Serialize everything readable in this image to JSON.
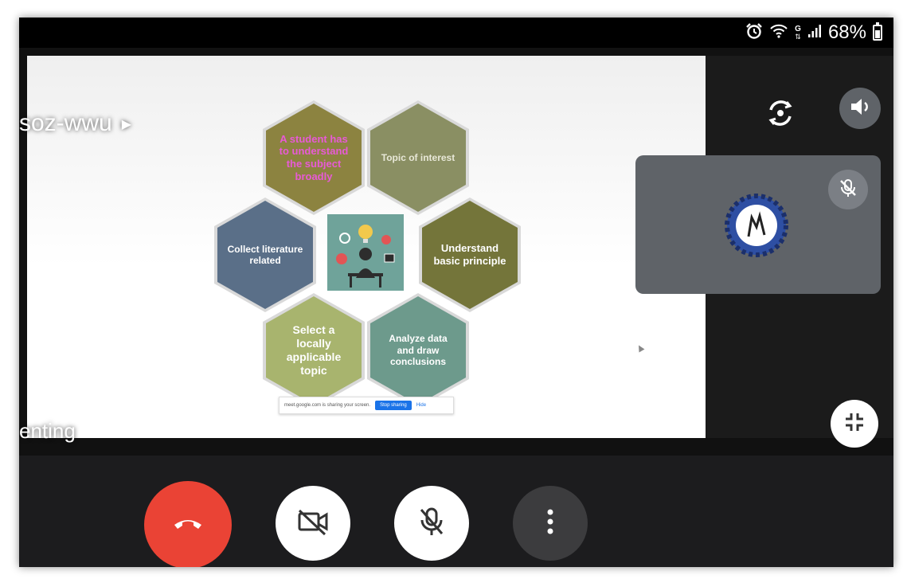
{
  "status_bar": {
    "icons": [
      "alarm-icon",
      "wifi-icon",
      "data-icon",
      "signal-icon"
    ],
    "data_label": "G",
    "battery_percent": "68%",
    "battery_level": 0.68
  },
  "meeting": {
    "code": "soz-wwu",
    "presenting_text": "enting"
  },
  "slide": {
    "hexagons": [
      {
        "text": "A student has to understand the subject broadly",
        "fill": "#8c8340",
        "text_color": "#e85ad6"
      },
      {
        "text": "Topic of interest",
        "fill": "#8a8f63",
        "text_color": "#e8e8d8"
      },
      {
        "text": "Collect literature related",
        "fill": "#5a6f88",
        "text_color": "#ffffff"
      },
      {
        "text": "Understand basic principle",
        "fill": "#74753a",
        "text_color": "#ffffff"
      },
      {
        "text": "Select a locally applicable topic",
        "fill": "#a8b46e",
        "text_color": "#ffffff"
      },
      {
        "text": "Analyze data and draw conclusions",
        "fill": "#6d9a8c",
        "text_color": "#ffffff"
      }
    ],
    "share_bar": {
      "message": "meet.google.com is sharing your screen.",
      "stop_label": "Stop sharing",
      "hide_label": "Hide"
    }
  },
  "controls": {
    "end_call_color": "#ea4335",
    "button_bg": "#ffffff",
    "more_bg": "#3c3c3e",
    "icons": [
      "end-call-icon",
      "camera-off-icon",
      "mic-off-icon",
      "more-vert-icon"
    ]
  },
  "top_buttons": {
    "icons": [
      "switch-camera-icon",
      "speaker-icon",
      "exit-fullscreen-icon"
    ]
  }
}
